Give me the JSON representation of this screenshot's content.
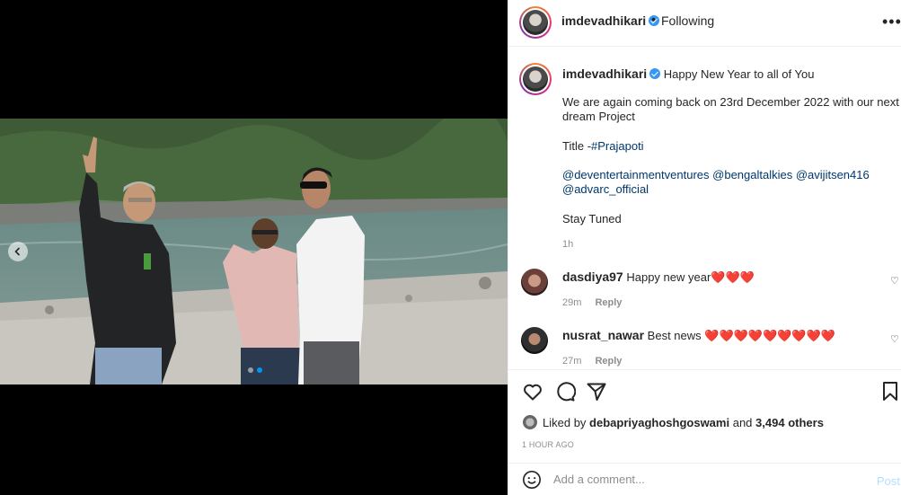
{
  "post": {
    "username": "imdevadhikari",
    "follow_sep": "•",
    "follow_state": "Following",
    "more_icon": "more-horizontal-icon",
    "caption": {
      "intro": "Happy New Year to all of You",
      "line1": "We are again coming back on 23rd December 2022 with our next",
      "line2": "dream Project",
      "title_prefix": "Title -",
      "title_tag": "#Prajapoti",
      "mentions_line1": [
        "@deventertainmentventures",
        "@bengaltalkies",
        "@avijitsen416"
      ],
      "mentions_line2": [
        "@advarc_official"
      ],
      "outro": "Stay Tuned",
      "time": "1h"
    },
    "comments": [
      {
        "username": "dasdiya97",
        "text": "Happy new year",
        "hearts": "❤️❤️❤️",
        "time": "29m",
        "reply": "Reply"
      },
      {
        "username": "nusrat_nawar",
        "text": "Best news",
        "hearts": "❤️❤️❤️❤️❤️❤️❤️❤️❤️",
        "time": "27m",
        "reply": "Reply"
      }
    ],
    "likes": {
      "prefix": "Liked by",
      "user": "debapriyaghoshgoswami",
      "mid": "and",
      "count": "3,494 others"
    },
    "time_ago": "1 HOUR AGO",
    "add_comment": {
      "placeholder": "Add a comment...",
      "post_label": "Post"
    },
    "carousel": {
      "current": 2,
      "total": 2
    }
  },
  "colors": {
    "accent": "#0095f6",
    "link": "#00376b",
    "heart": "#ed4956"
  }
}
